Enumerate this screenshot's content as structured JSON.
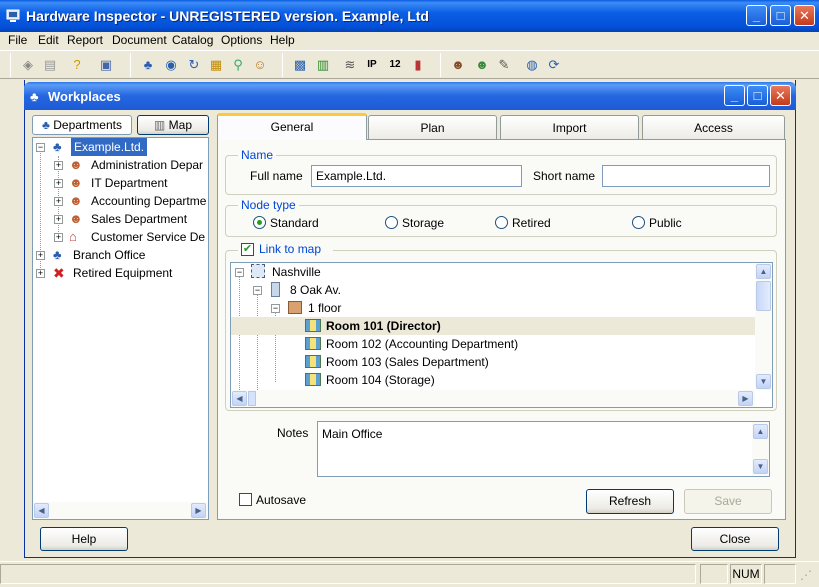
{
  "app": {
    "title": "Hardware Inspector - UNREGISTERED version. Example, Ltd",
    "window_buttons": {
      "minimize": "_",
      "maximize": "□",
      "close": "✕"
    }
  },
  "menu": [
    "File",
    "Edit",
    "Report",
    "Document",
    "Catalog",
    "Options",
    "Help"
  ],
  "toolbar_icons": [
    "workplaces-icon",
    "document-icon",
    "help-icon",
    "window-icon",
    "network-icon",
    "scan-icon",
    "refresh-icon",
    "computers-icon",
    "search-icon",
    "user-search-icon",
    "map-icon",
    "hardware-icon",
    "network-cards-icon",
    "ip-icon",
    "numbers-icon",
    "statistics-icon",
    "user-icon",
    "users-settings-icon",
    "tools-icon",
    "globe-icon",
    "sync-icon"
  ],
  "child": {
    "title": "Workplaces",
    "left_tabs": {
      "departments": "Departments",
      "map": "Map"
    },
    "tree": [
      {
        "label": "Example.Ltd.",
        "level": 0,
        "selected": true
      },
      {
        "label": "Administration Depar",
        "level": 1
      },
      {
        "label": "IT Department",
        "level": 1
      },
      {
        "label": "Accounting Departme",
        "level": 1
      },
      {
        "label": "Sales Department",
        "level": 1
      },
      {
        "label": "Customer Service De",
        "level": 1
      },
      {
        "label": "Branch Office",
        "level": 0
      },
      {
        "label": "Retired Equipment",
        "level": 0
      }
    ],
    "tabs": {
      "general": "General",
      "plan": "Plan",
      "import": "Import",
      "access": "Access"
    },
    "name_group": {
      "label": "Name",
      "full_name_label": "Full name",
      "full_name_value": "Example.Ltd.",
      "short_name_label": "Short name",
      "short_name_value": ""
    },
    "node_type": {
      "label": "Node type",
      "options": [
        "Standard",
        "Storage",
        "Retired",
        "Public"
      ],
      "selected": "Standard"
    },
    "link_to_map": {
      "label": "Link to map",
      "checked": true,
      "tree": [
        {
          "label": "Nashville"
        },
        {
          "label": "8 Oak Av."
        },
        {
          "label": "1 floor"
        },
        {
          "label": "Room 101 (Director)",
          "bold": true
        },
        {
          "label": "Room 102 (Accounting Department)"
        },
        {
          "label": "Room 103 (Sales Department)"
        },
        {
          "label": "Room 104 (Storage)"
        }
      ]
    },
    "notes": {
      "label": "Notes",
      "value": "Main Office"
    },
    "autosave_label": "Autosave",
    "refresh_label": "Refresh",
    "save_label": "Save",
    "help_label": "Help",
    "close_label": "Close"
  },
  "statusbar": {
    "num": "NUM"
  },
  "colors": {
    "accent": "#0a5ce3",
    "selection": "#316ac5"
  }
}
